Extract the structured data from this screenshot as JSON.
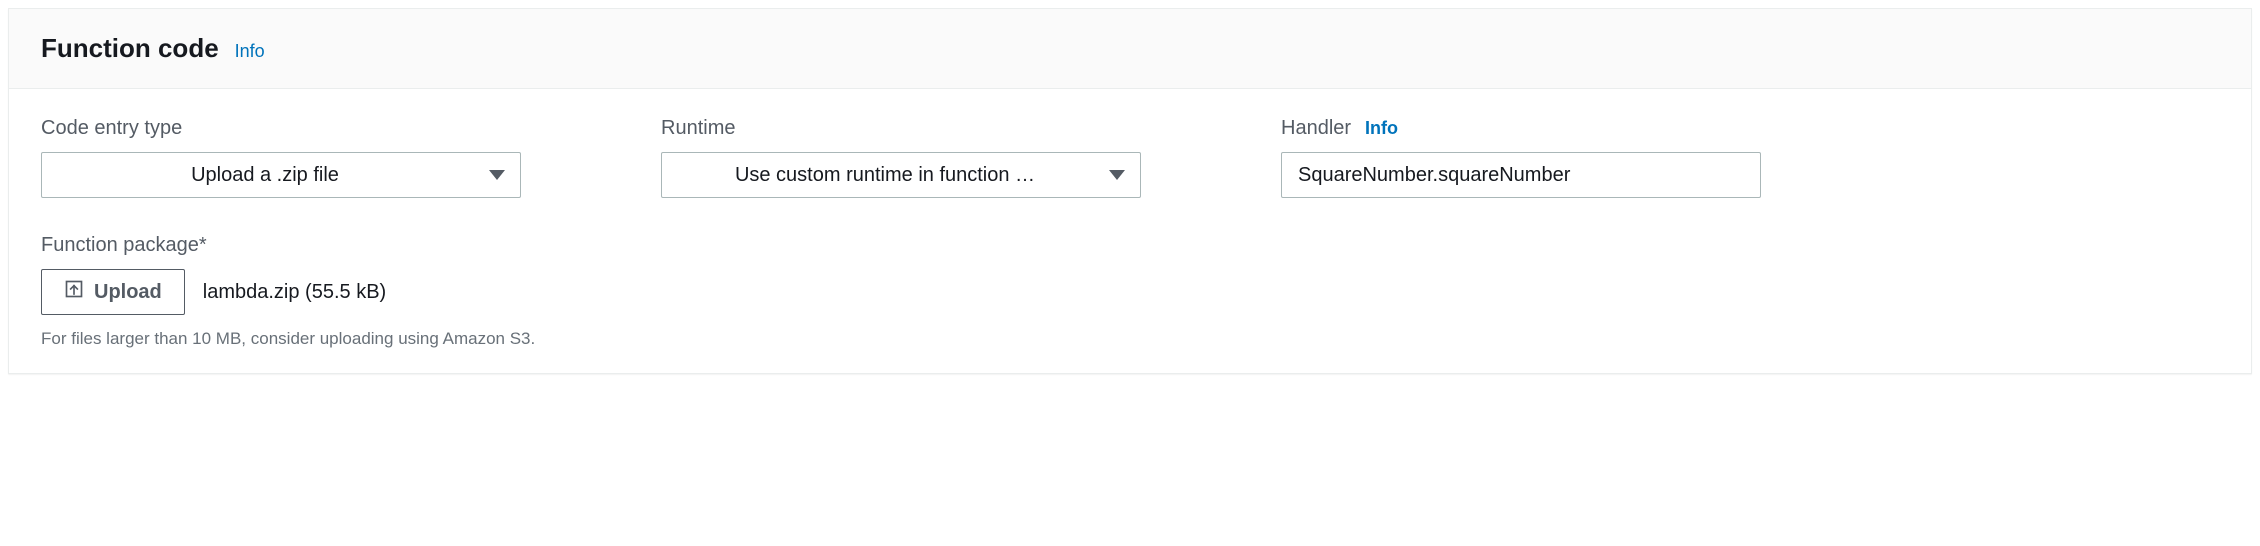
{
  "panel": {
    "title": "Function code",
    "info_label": "Info"
  },
  "fields": {
    "code_entry": {
      "label": "Code entry type",
      "value": "Upload a .zip file"
    },
    "runtime": {
      "label": "Runtime",
      "value": "Use custom runtime in function …"
    },
    "handler": {
      "label": "Handler",
      "info_label": "Info",
      "value": "SquareNumber.squareNumber"
    },
    "function_package": {
      "label": "Function package*",
      "upload_button": "Upload",
      "filename": "lambda.zip (55.5 kB)",
      "help": "For files larger than 10 MB, consider uploading using Amazon S3."
    }
  }
}
